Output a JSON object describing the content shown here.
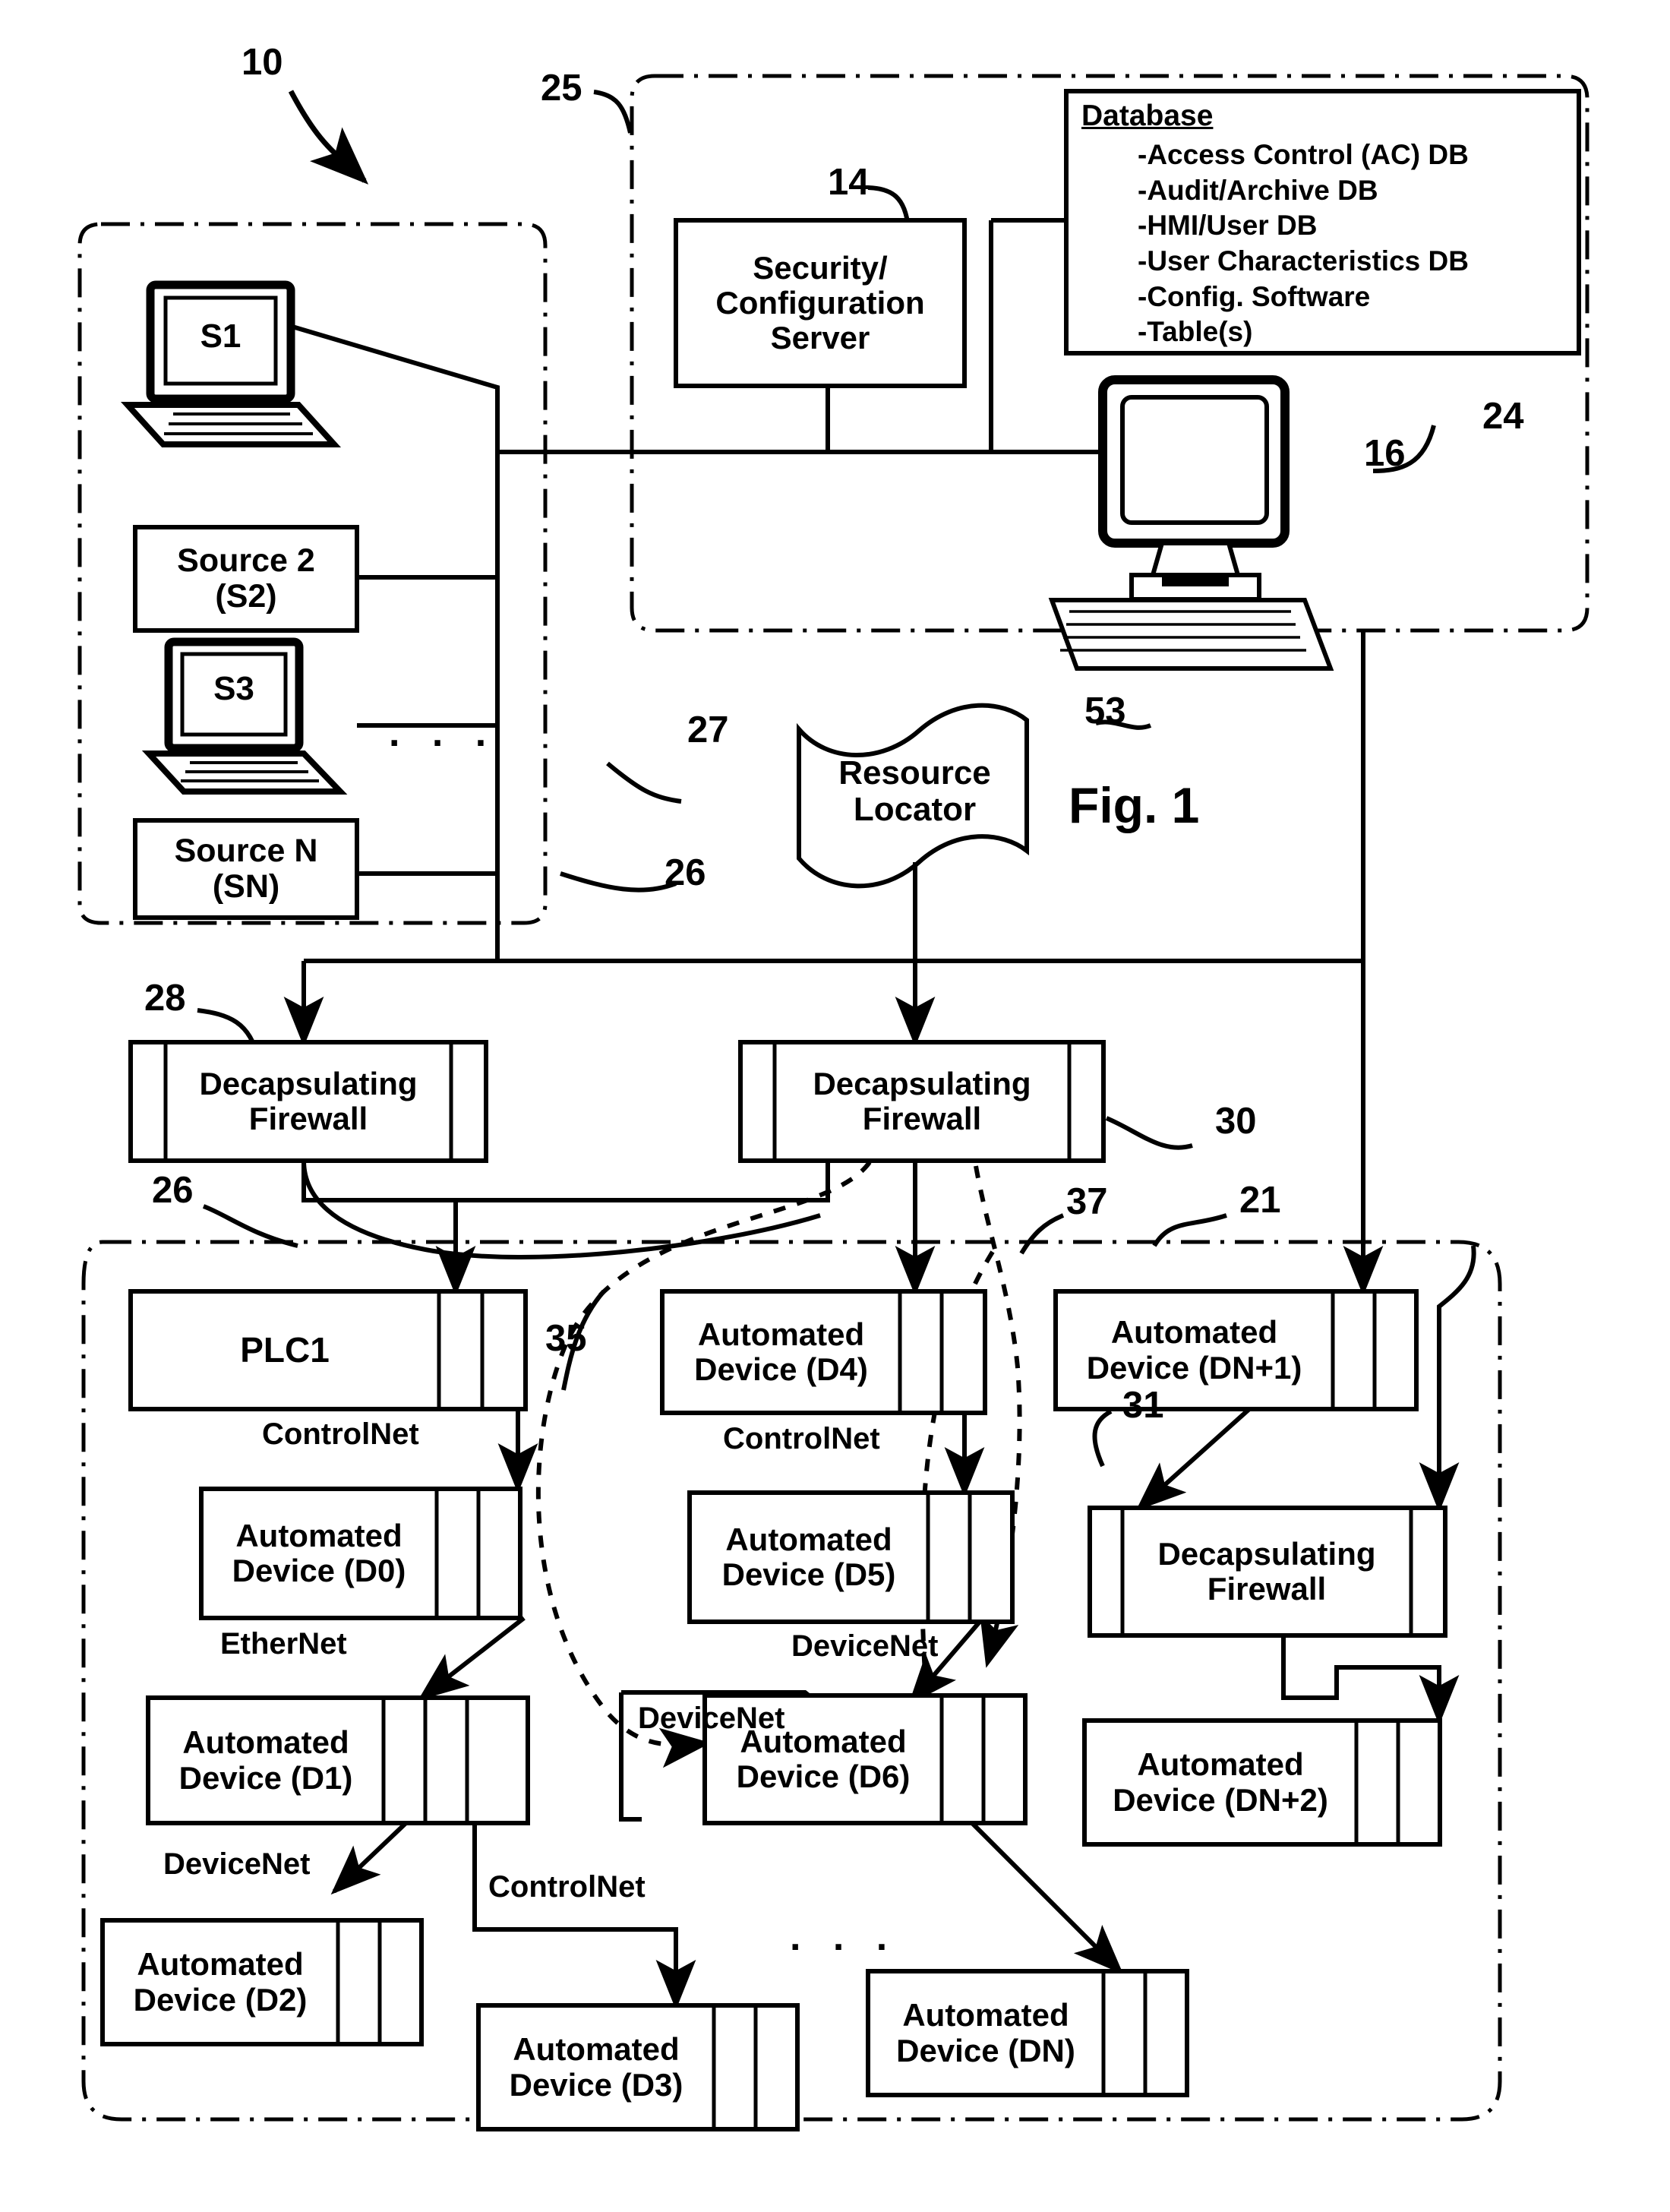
{
  "figure": {
    "label": "Fig. 1",
    "system_ref": "10"
  },
  "zones": {
    "server_zone_ref": "25",
    "source_zone_ref": "27",
    "plant_zone_ref": "37",
    "plant_zone_ref_b": "21"
  },
  "server_zone": {
    "security_server": {
      "ref": "14",
      "label": "Security/\nConfiguration\nServer",
      "line1": "Security/",
      "line2": "Configuration",
      "line3": "Server"
    },
    "database": {
      "ref": "24",
      "title": "Database",
      "items": [
        "-Access Control (AC) DB",
        "-Audit/Archive DB",
        "-HMI/User DB",
        "-User Characteristics DB",
        "-Config. Software",
        "-Table(s)"
      ]
    },
    "workstation": {
      "ref": "16",
      "icon": "desktop-computer-icon"
    }
  },
  "source_zone": {
    "sources": [
      {
        "name": "S1",
        "type": "laptop",
        "icon": "laptop-icon"
      },
      {
        "name": "Source 2",
        "sub": "(S2)",
        "type": "box"
      },
      {
        "name": "S3",
        "type": "laptop",
        "icon": "laptop-icon"
      },
      {
        "name": "Source N",
        "sub": "(SN)",
        "type": "box"
      }
    ],
    "ellipsis": ". . .",
    "bus_ref_top": "27",
    "bus_ref_bottom": "26"
  },
  "resource_locator": {
    "ref": "53",
    "line1": "Resource",
    "line2": "Locator",
    "icon": "banner-flag-icon"
  },
  "firewalls": [
    {
      "id": "fw-left",
      "ref": "28",
      "line1": "Decapsulating",
      "line2": "Firewall"
    },
    {
      "id": "fw-mid",
      "ref": "30",
      "line1": "Decapsulating",
      "line2": "Firewall"
    },
    {
      "id": "fw-right",
      "ref": "31",
      "line1": "Decapsulating",
      "line2": "Firewall"
    }
  ],
  "bus_ref_plant": "26",
  "plant_zone": {
    "devices": [
      {
        "id": "plc1",
        "line1": "PLC1",
        "line2": "",
        "slots": 2
      },
      {
        "id": "d0",
        "line1": "Automated",
        "line2": "Device (D0)",
        "slots": 2
      },
      {
        "id": "d1",
        "line1": "Automated",
        "line2": "Device (D1)",
        "slots": 3
      },
      {
        "id": "d2",
        "line1": "Automated",
        "line2": "Device (D2)",
        "slots": 2
      },
      {
        "id": "d3",
        "line1": "Automated",
        "line2": "Device (D3)",
        "slots": 2
      },
      {
        "id": "d4",
        "line1": "Automated",
        "line2": "Device (D4)",
        "slots": 2
      },
      {
        "id": "d5",
        "line1": "Automated",
        "line2": "Device (D5)",
        "slots": 2
      },
      {
        "id": "d6",
        "line1": "Automated",
        "line2": "Device (D6)",
        "slots": 2
      },
      {
        "id": "dn",
        "line1": "Automated",
        "line2": "Device (DN)",
        "slots": 2
      },
      {
        "id": "dn1",
        "line1": "Automated",
        "line2": "Device (DN+1)",
        "slots": 2
      },
      {
        "id": "dn2",
        "line1": "Automated",
        "line2": "Device (DN+2)",
        "slots": 2
      }
    ],
    "network_labels": [
      {
        "id": "net-plc1-d0",
        "text": "ControlNet"
      },
      {
        "id": "net-d0-d1",
        "text": "EtherNet"
      },
      {
        "id": "net-d1-d2",
        "text": "DeviceNet"
      },
      {
        "id": "net-d1-d3",
        "text": "ControlNet"
      },
      {
        "id": "net-d4-d5",
        "text": "ControlNet"
      },
      {
        "id": "net-d5-d6",
        "text": "DeviceNet"
      },
      {
        "id": "net-d6-in",
        "text": "DeviceNet"
      }
    ],
    "ellipsis": ". . .",
    "dashed_path_ref": "35"
  }
}
